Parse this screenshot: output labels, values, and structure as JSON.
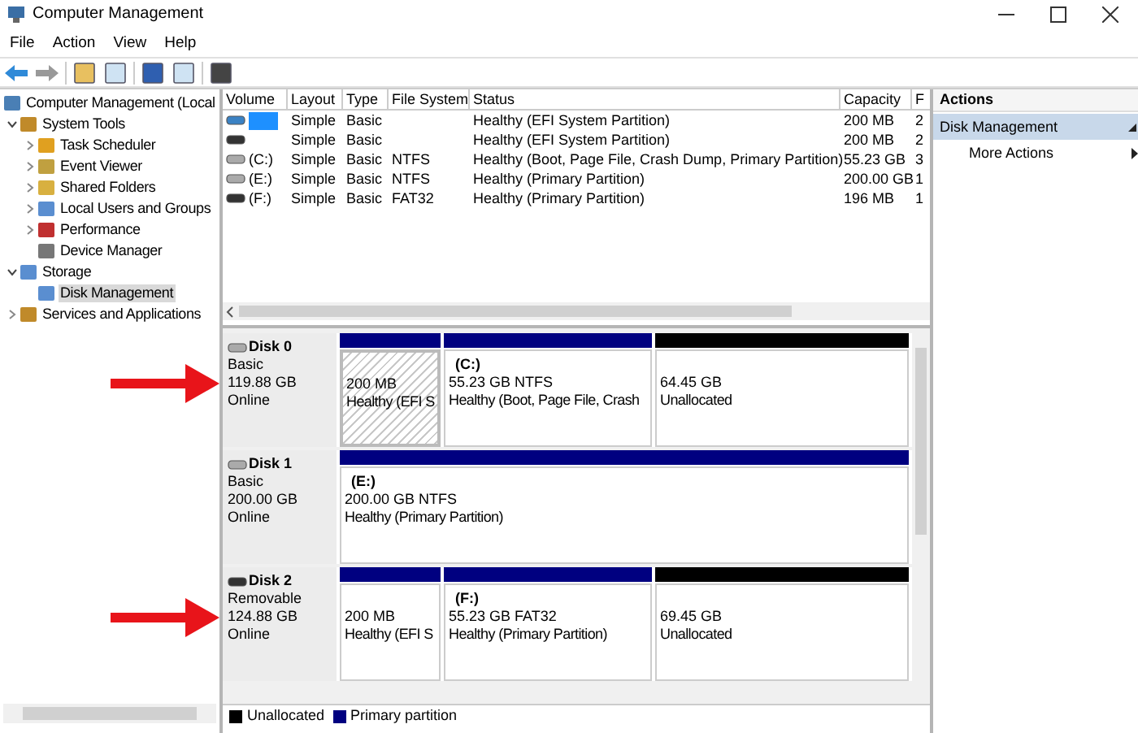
{
  "window": {
    "title": "Computer Management"
  },
  "menu": [
    "File",
    "Action",
    "View",
    "Help"
  ],
  "tree": [
    {
      "label": "Computer Management (Local",
      "children": [
        {
          "label": "System Tools",
          "expanded": true,
          "children": [
            {
              "label": "Task Scheduler",
              "expanded": false
            },
            {
              "label": "Event Viewer",
              "expanded": false
            },
            {
              "label": "Shared Folders",
              "expanded": false
            },
            {
              "label": "Local Users and Groups",
              "expanded": false
            },
            {
              "label": "Performance",
              "expanded": false
            },
            {
              "label": "Device Manager",
              "selected": false
            }
          ]
        },
        {
          "label": "Storage",
          "expanded": true,
          "children": [
            {
              "label": "Disk Management",
              "selected": true
            }
          ]
        },
        {
          "label": "Services and Applications",
          "expanded": false
        }
      ]
    }
  ],
  "volumes": {
    "columns": [
      "Volume",
      "Layout",
      "Type",
      "File System",
      "Status",
      "Capacity",
      "F"
    ],
    "rows": [
      {
        "selected": true,
        "kind": "fixed",
        "layout": "Simple",
        "type": "Basic",
        "status": "Healthy (EFI System Partition)",
        "capacity": "200 MB",
        "column_7": "2"
      },
      {
        "selected": false,
        "kind": "removable",
        "layout": "Simple",
        "type": "Basic",
        "status": "Healthy (EFI System Partition)",
        "capacity": "200 MB",
        "column_7": "2"
      },
      {
        "selected": false,
        "kind": "fixed",
        "volume": "(C:)",
        "layout": "Simple",
        "type": "Basic",
        "file_system": "NTFS",
        "status": "Healthy (Boot, Page File, Crash Dump, Primary Partition)",
        "capacity": "55.23 GB",
        "column_7": "3"
      },
      {
        "selected": false,
        "kind": "fixed",
        "volume": "(E:)",
        "layout": "Simple",
        "type": "Basic",
        "file_system": "NTFS",
        "status": "Healthy (Primary Partition)",
        "capacity": "200.00 GB",
        "column_7": "1"
      },
      {
        "selected": false,
        "kind": "removable",
        "volume": "(F:)",
        "layout": "Simple",
        "type": "Basic",
        "file_system": "FAT32",
        "status": "Healthy (Primary Partition)",
        "capacity": "196 MB",
        "column_7": "1"
      }
    ]
  },
  "disks": [
    {
      "name": "Disk 0",
      "kind": "fixed",
      "marked": true,
      "disk_type": "Basic",
      "size": "119.88 GB",
      "state": "Online",
      "partitions": [
        {
          "kind": "primary",
          "selected": true,
          "size": "200 MB",
          "status": "Healthy (EFI S"
        },
        {
          "kind": "primary",
          "selected": false,
          "label": "(C:)",
          "size": "55.23 GB NTFS",
          "status": "Healthy (Boot, Page File, Crash"
        },
        {
          "kind": "unallocated",
          "selected": false,
          "size": "64.45 GB",
          "status": "Unallocated"
        }
      ]
    },
    {
      "name": "Disk 1",
      "kind": "fixed",
      "disk_type": "Basic",
      "size": "200.00 GB",
      "state": "Online",
      "partitions": [
        {
          "kind": "primary",
          "selected": false,
          "label": "(E:)",
          "size": "200.00 GB NTFS",
          "status": "Healthy (Primary Partition)"
        }
      ]
    },
    {
      "name": "Disk 2",
      "kind": "removable",
      "marked": true,
      "disk_type": "Removable",
      "size": "124.88 GB",
      "state": "Online",
      "partitions": [
        {
          "kind": "primary",
          "selected": false,
          "size": "200 MB",
          "status": "Healthy (EFI S"
        },
        {
          "kind": "primary",
          "selected": false,
          "label": "(F:)",
          "size": "55.23 GB FAT32",
          "status": "Healthy (Primary Partition)"
        },
        {
          "kind": "unallocated",
          "selected": false,
          "size": "69.45 GB",
          "status": "Unallocated"
        }
      ]
    }
  ],
  "legend": [
    {
      "kind": "unallocated",
      "label": "Unallocated"
    },
    {
      "kind": "primary",
      "label": "Primary partition"
    }
  ],
  "actions": {
    "title": "Actions",
    "section": "Disk Management",
    "items": [
      "More Actions"
    ]
  }
}
